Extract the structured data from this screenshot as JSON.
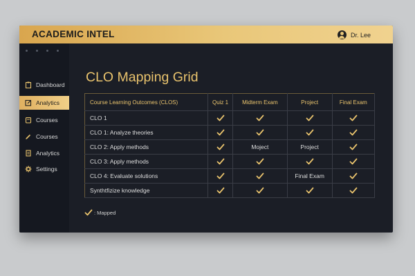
{
  "header": {
    "app_title": "ACADEMIC INTEL",
    "user_name": "Dr. Lee"
  },
  "sidebar": {
    "items": [
      {
        "label": "Dashboard",
        "icon": "clipboard-icon",
        "active": false
      },
      {
        "label": "Analytics",
        "icon": "edit-icon",
        "active": true
      },
      {
        "label": "Courses",
        "icon": "book-icon",
        "active": false
      },
      {
        "label": "Courses",
        "icon": "pen-icon",
        "active": false
      },
      {
        "label": "Analytics",
        "icon": "document-icon",
        "active": false
      },
      {
        "label": "Settings",
        "icon": "gear-icon",
        "active": false
      }
    ]
  },
  "main": {
    "title": "CLO Mapping Grid",
    "columns": [
      "Course Learning Outcomes (CLOS)",
      "Quiz 1",
      "Midterm Exam",
      "Project",
      "Final Exam"
    ],
    "rows": [
      {
        "outcome": "CLO 1",
        "cells": [
          "✓",
          "✓",
          "✓",
          "✓"
        ]
      },
      {
        "outcome": "CLO 1: Analyze theories",
        "cells": [
          "✓",
          "✓",
          "✓",
          "✓"
        ]
      },
      {
        "outcome": "CLO 2: Apply methods",
        "cells": [
          "✓",
          "Moject",
          "Project",
          "✓"
        ]
      },
      {
        "outcome": "CLO 3: Apply  methods",
        "cells": [
          "✓",
          "✓",
          "✓",
          "✓"
        ]
      },
      {
        "outcome": "CLO 4: Evaluate solutions",
        "cells": [
          "✓",
          "✓",
          "Final Exam",
          "✓"
        ]
      },
      {
        "outcome": "Synthtfizize knowledge",
        "cells": [
          "✓",
          "✓",
          "✓",
          "✓"
        ]
      }
    ],
    "legend": ": Mapped"
  },
  "colors": {
    "accent": "#e9c36d",
    "background": "#1b1e26",
    "sidebar": "#151820",
    "topbar_start": "#d9a64e",
    "topbar_end": "#f0d28f"
  }
}
